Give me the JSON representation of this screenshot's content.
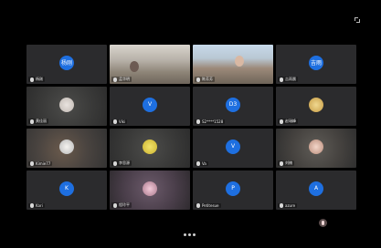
{
  "participants": [
    {
      "name": "杨刚",
      "avatar_type": "initial",
      "avatar_text": "杨刚",
      "bg": "dark"
    },
    {
      "name": "孟华明",
      "avatar_type": "video",
      "avatar_text": "",
      "bg": "video1"
    },
    {
      "name": "陈芳芳",
      "avatar_type": "video",
      "avatar_text": "",
      "bg": "video2"
    },
    {
      "name": "吉雨晨",
      "avatar_type": "initial",
      "avatar_text": "吉雨",
      "bg": "dark"
    },
    {
      "name": "黄佳丽",
      "avatar_type": "image",
      "avatar_text": "",
      "bg": "blur1"
    },
    {
      "name": "Viki",
      "avatar_type": "initial",
      "avatar_text": "V",
      "bg": "dark"
    },
    {
      "name": "S2****1528",
      "avatar_type": "initial",
      "avatar_text": "D3",
      "bg": "dark"
    },
    {
      "name": "赵瑞峰",
      "avatar_type": "image",
      "avatar_text": "",
      "bg": "dark"
    },
    {
      "name": "Kimie77",
      "avatar_type": "image",
      "avatar_text": "",
      "bg": "blur2"
    },
    {
      "name": "李思源",
      "avatar_type": "image",
      "avatar_text": "",
      "bg": "blur1"
    },
    {
      "name": "Va",
      "avatar_type": "initial",
      "avatar_text": "V",
      "bg": "dark"
    },
    {
      "name": "刘楠",
      "avatar_type": "image",
      "avatar_text": "",
      "bg": "blur4"
    },
    {
      "name": "Kari",
      "avatar_type": "initial",
      "avatar_text": "K",
      "bg": "dark"
    },
    {
      "name": "程玲平",
      "avatar_type": "image",
      "avatar_text": "",
      "bg": "blur3"
    },
    {
      "name": "Petitesue",
      "avatar_type": "initial",
      "avatar_text": "P",
      "bg": "dark"
    },
    {
      "name": "azure",
      "avatar_type": "initial",
      "avatar_text": "A",
      "bg": "dark"
    }
  ],
  "icons": {
    "expand": "expand-icon",
    "mic": "mic-icon",
    "pager_dots": 3,
    "self_mic": "mic-icon"
  },
  "colors": {
    "avatar_blue": "#1e6fe0",
    "tile_bg": "#2b2b2d",
    "page_bg": "#000000"
  }
}
